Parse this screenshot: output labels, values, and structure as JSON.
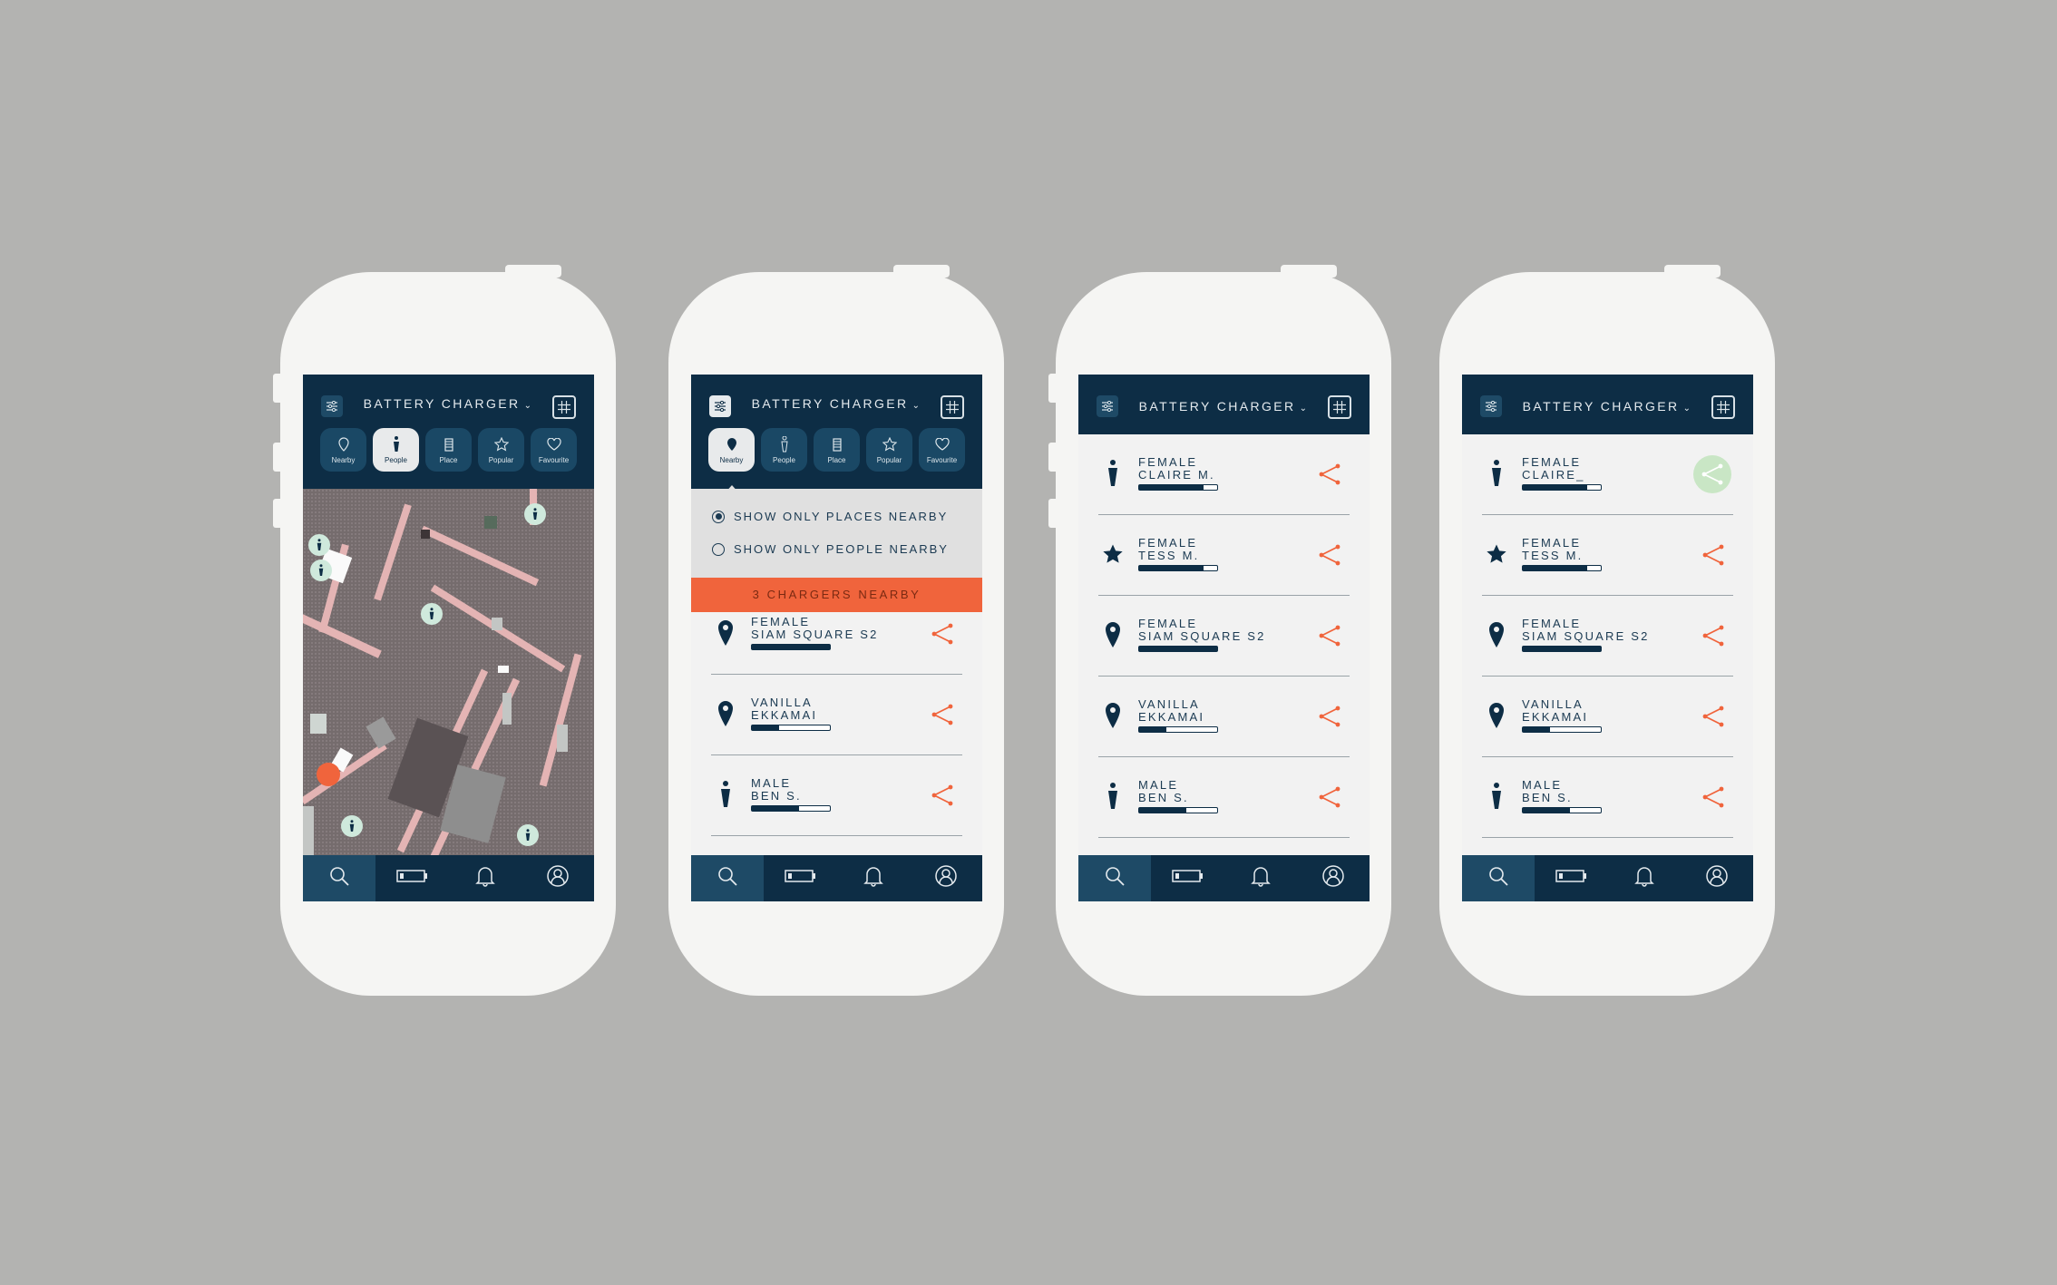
{
  "app": {
    "title": "BATTERY CHARGER"
  },
  "colors": {
    "navy": "#0d2d45",
    "accent": "#f0643c",
    "pin": "#cfe9dc",
    "share_highlight": "#c9e6c5"
  },
  "icons": {
    "filter": "filter-icon",
    "map_toggle": "map-grid-icon",
    "search": "search-icon",
    "battery": "battery-icon",
    "bell": "bell-icon",
    "profile": "profile-icon",
    "share": "share-icon"
  },
  "tabs": [
    {
      "label": "Nearby",
      "icon": "pin-icon"
    },
    {
      "label": "People",
      "icon": "person-icon"
    },
    {
      "label": "Place",
      "icon": "building-icon"
    },
    {
      "label": "Popular",
      "icon": "star-icon"
    },
    {
      "label": "Favourite",
      "icon": "heart-icon"
    }
  ],
  "screen1": {
    "active_tab": "People"
  },
  "screen2": {
    "active_tab": "Nearby",
    "filter_options": [
      {
        "label": "SHOW ONLY PLACES NEARBY",
        "selected": true
      },
      {
        "label": "SHOW ONLY PEOPLE NEARBY",
        "selected": false
      }
    ],
    "banner": "3 CHARGERS NEARBY",
    "items": [
      {
        "title": "FEMALE",
        "subtitle": "SIAM SQUARE S2",
        "icon": "pin-icon",
        "battery_level": 1.0
      },
      {
        "title": "VANILLA",
        "subtitle": "EKKAMAI",
        "icon": "pin-icon",
        "battery_level": 0.35
      },
      {
        "title": "MALE",
        "subtitle": "BEN S.",
        "icon": "person-icon",
        "battery_level": 0.6
      }
    ]
  },
  "screen3": {
    "items": [
      {
        "title": "FEMALE",
        "subtitle": "CLAIRE M.",
        "icon": "person-icon",
        "battery_level": 0.82
      },
      {
        "title": "FEMALE",
        "subtitle": "TESS M.",
        "icon": "star-icon",
        "battery_level": 0.82
      },
      {
        "title": "FEMALE",
        "subtitle": "SIAM SQUARE S2",
        "icon": "pin-icon",
        "battery_level": 1.0
      },
      {
        "title": "VANILLA",
        "subtitle": "EKKAMAI",
        "icon": "pin-icon",
        "battery_level": 0.35
      },
      {
        "title": "MALE",
        "subtitle": "BEN S.",
        "icon": "person-icon",
        "battery_level": 0.6
      }
    ]
  },
  "screen4": {
    "items": [
      {
        "title": "FEMALE",
        "subtitle": "CLAIRE_",
        "icon": "person-icon",
        "battery_level": 0.82
      },
      {
        "title": "FEMALE",
        "subtitle": "TESS M.",
        "icon": "star-icon",
        "battery_level": 0.82
      },
      {
        "title": "FEMALE",
        "subtitle": "SIAM SQUARE S2",
        "icon": "pin-icon",
        "battery_level": 1.0
      },
      {
        "title": "VANILLA",
        "subtitle": "EKKAMAI",
        "icon": "pin-icon",
        "battery_level": 0.35
      },
      {
        "title": "MALE",
        "subtitle": "BEN S.",
        "icon": "person-icon",
        "battery_level": 0.6
      }
    ]
  }
}
